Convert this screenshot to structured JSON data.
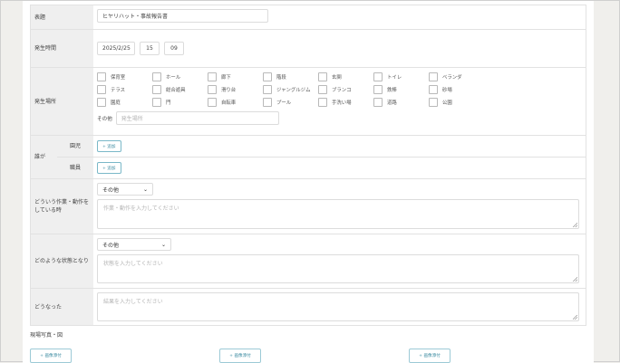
{
  "form": {
    "title": {
      "label": "表題",
      "value": "ヒヤリハット・事故報告書"
    },
    "datetime": {
      "label": "発生時間",
      "date": "2025/2/25",
      "hour": "15",
      "minute": "09"
    },
    "location": {
      "label": "発生場所",
      "options": [
        "保育室",
        "ホール",
        "廊下",
        "階段",
        "玄関",
        "トイレ",
        "ベランダ",
        "テラス",
        "総合遊具",
        "滑り台",
        "ジャングルジム",
        "ブランコ",
        "鉄棒",
        "砂場",
        "園庭",
        "門",
        "自転車",
        "プール",
        "手洗い場",
        "道路",
        "公園"
      ],
      "other_label": "その他",
      "other_placeholder": "発生場所"
    },
    "who": {
      "label": "誰が",
      "sub": [
        {
          "label": "園児",
          "button": "+ 追加"
        },
        {
          "label": "職員",
          "button": "+ 追加"
        }
      ]
    },
    "action": {
      "label": "どういう作業・動作をしている時",
      "select": "その他",
      "placeholder": "作業・動作を入力してください"
    },
    "state": {
      "label": "どのような状態となり",
      "select": "その他",
      "placeholder": "状態を入力してください"
    },
    "result": {
      "label": "どうなった",
      "placeholder": "結果を入力してください"
    }
  },
  "photos": {
    "label": "現場写真・図",
    "attach_label": "+ 画像添付"
  }
}
